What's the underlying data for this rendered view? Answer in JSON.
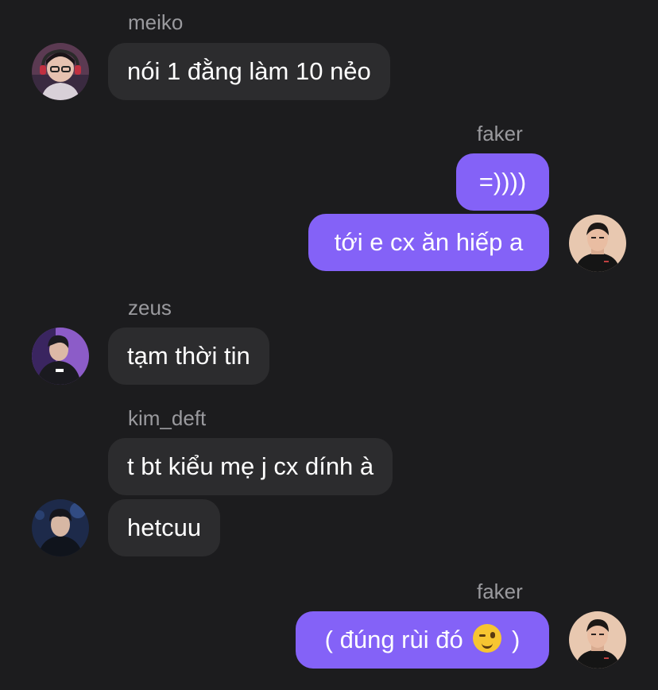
{
  "messages": [
    {
      "sender": "meiko",
      "text": "nói 1 đằng làm 10 nẻo"
    },
    {
      "sender": "faker",
      "texts": [
        "=))))",
        "tới e cx ăn hiếp a"
      ]
    },
    {
      "sender": "zeus",
      "text": "tạm thời tin"
    },
    {
      "sender": "kim_deft",
      "texts": [
        "t bt kiểu mẹ j cx dính à",
        "hetcuu"
      ]
    },
    {
      "sender": "faker",
      "text_before": "( đúng rùi đó",
      "text_after": ")",
      "emoji": "winking-face-icon"
    }
  ],
  "colors": {
    "background": "#1c1c1e",
    "incoming_bubble": "#2c2c2e",
    "outgoing_bubble": "#8462f7",
    "sender_text": "#9a9a9e"
  }
}
